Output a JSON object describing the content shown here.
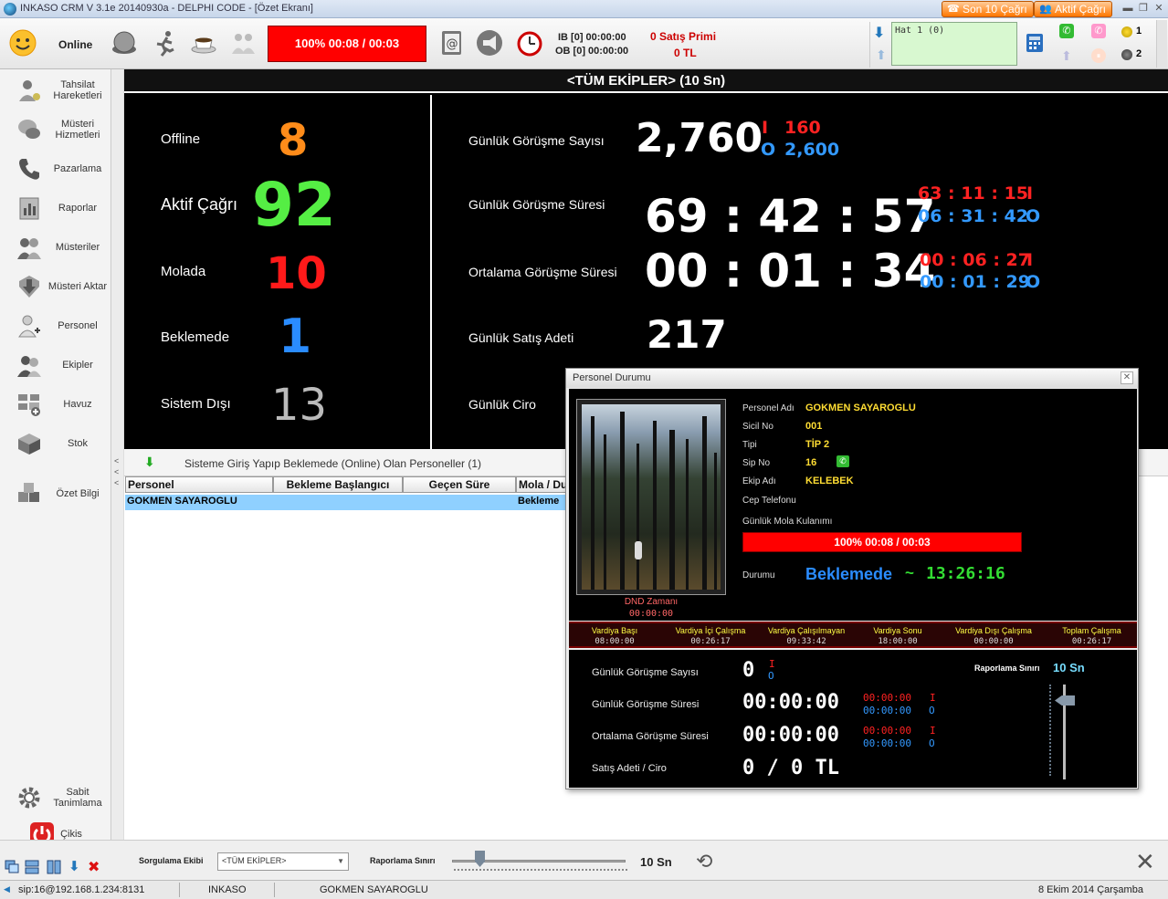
{
  "window": {
    "title": "INKASO CRM V 3.1e 20140930a  -  DELPHI CODE - [Özet Ekranı]",
    "son10": "Son 10 Çağrı",
    "aktif": "Aktif Çağrı"
  },
  "toolbar": {
    "status": "Online",
    "timer": "100% 00:08 / 00:03",
    "ib": "IB [0] 00:00:00",
    "ob": "OB [0] 00:00:00",
    "satis_primi": "0 Satış Primi",
    "prim_tl": "0 TL",
    "hat": "Hat 1 (0)",
    "radio1": "1",
    "radio2": "2"
  },
  "sidebar": {
    "items": [
      {
        "label": "Tahsilat Hareketleri"
      },
      {
        "label": "Müsteri Hizmetleri"
      },
      {
        "label": "Pazarlama"
      },
      {
        "label": "Raporlar"
      },
      {
        "label": "Müsteriler"
      },
      {
        "label": "Müsteri Aktar"
      },
      {
        "label": "Personel"
      },
      {
        "label": "Ekipler"
      },
      {
        "label": "Havuz"
      },
      {
        "label": "Stok"
      },
      {
        "label": "Özet Bilgi"
      }
    ],
    "sabit": "Sabit Tanimlama",
    "cikis": "Çikis"
  },
  "dashboard": {
    "title": "<TÜM EKİPLER> (10 Sn)",
    "stats": [
      {
        "label": "Offline",
        "value": "8",
        "color": "#ff8c1a"
      },
      {
        "label": "Aktif Çağrı",
        "value": "92",
        "color": "#55ee44"
      },
      {
        "label": "Molada",
        "value": "10",
        "color": "#ff1a1a"
      },
      {
        "label": "Beklemede",
        "value": "1",
        "color": "#2a8cff"
      },
      {
        "label": "Sistem Dışı",
        "value": "13",
        "color": "#bbbbbb"
      }
    ],
    "kpis": {
      "gorusme_sayisi_label": "Günlük Görüşme  Sayısı",
      "gorusme_sayisi": "2,760",
      "gorusme_sayisi_i": "160",
      "gorusme_sayisi_o": "2,600",
      "gorusme_suresi_label": "Günlük Görüşme Süresi",
      "gorusme_suresi": "69 : 42 : 57",
      "gorusme_suresi_i": "63 : 11 : 15",
      "gorusme_suresi_o": "06 : 31 : 42",
      "ortalama_label": "Ortalama Görüşme Süresi",
      "ortalama": "00 : 01 : 34",
      "ortalama_i": "00 : 06 : 27",
      "ortalama_o": "00 : 01 : 29",
      "satis_adeti_label": "Günlük Satış Adeti",
      "satis_adeti": "217",
      "ciro_label": "Günlük Ciro",
      "i_marker": "I",
      "o_marker": "O"
    }
  },
  "online_list": {
    "title": "Sisteme Giriş Yapıp Beklemede (Online) Olan Personeller (1)",
    "columns": [
      "Personel",
      "Bekleme Başlangıcı",
      "Geçen Süre",
      "Mola / Du"
    ],
    "rows": [
      {
        "personel": "GOKMEN SAYAROGLU",
        "baslangic": "",
        "gecen": "",
        "mola": "Bekleme"
      }
    ]
  },
  "popup": {
    "title": "Personel Durumu",
    "dnd_label": "DND Zamanı",
    "dnd_value": "00:00:00",
    "fields": [
      {
        "label": "Personel Adı",
        "value": "GOKMEN SAYAROGLU"
      },
      {
        "label": "Sicil No",
        "value": "001"
      },
      {
        "label": "Tipi",
        "value": "TİP 2"
      },
      {
        "label": "Sip No",
        "value": "16"
      },
      {
        "label": "Ekip Adı",
        "value": "KELEBEK"
      },
      {
        "label": "Cep Telefonu",
        "value": ""
      }
    ],
    "mola_label": "Günlük Mola Kulanımı",
    "mola_value": "100% 00:08 / 00:03",
    "durum_label": "Durumu",
    "durum_value": "Beklemede",
    "durum_sep": "~",
    "durum_time": "13:26:16",
    "shifts": [
      {
        "label": "Vardiya Başı",
        "value": "08:00:00"
      },
      {
        "label": "Vardiya İçi Çalışma",
        "value": "00:26:17"
      },
      {
        "label": "Vardiya Çalışılmayan",
        "value": "09:33:42"
      },
      {
        "label": "Vardiya Sonu",
        "value": "18:00:00"
      },
      {
        "label": "Vardiya Dışı Çalışma",
        "value": "00:00:00"
      },
      {
        "label": "Toplam Çalışma",
        "value": "00:26:17"
      }
    ],
    "stats": {
      "sayisi_label": "Günlük Görüşme  Sayısı",
      "sayisi": "0",
      "suresi_label": "Günlük Görüşme Süresi",
      "suresi": "00:00:00",
      "suresi_i": "00:00:00",
      "suresi_o": "00:00:00",
      "ortalama_label": "Ortalama Görüşme Süresi",
      "ortalama": "00:00:00",
      "ortalama_i": "00:00:00",
      "ortalama_o": "00:00:00",
      "satis_label": "Satış Adeti / Ciro",
      "satis": "0  /  0  TL",
      "raporlama_label": "Raporlama Sınırı",
      "raporlama_value": "10 Sn"
    }
  },
  "footer": {
    "sorgulama_label": "Sorgulama Ekibi",
    "sorgulama_value": "<TÜM EKİPLER>",
    "raporlama_label": "Raporlama Sınırı",
    "raporlama_value": "10 Sn"
  },
  "statusbar": {
    "sip": "sip:16@192.168.1.234:8131",
    "company": "INKASO",
    "user": "GOKMEN SAYAROGLU",
    "date": "8 Ekim 2014 Çarşamba"
  }
}
